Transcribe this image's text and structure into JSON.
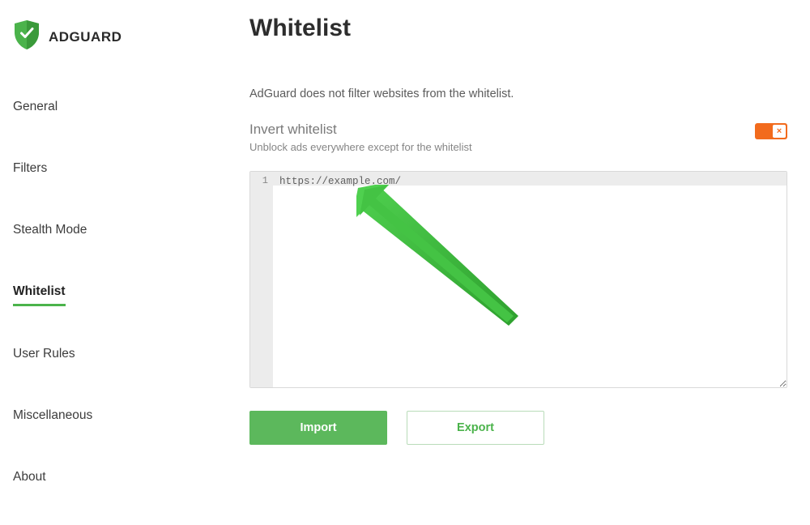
{
  "brand": {
    "name": "ADGUARD"
  },
  "sidebar": {
    "items": [
      {
        "label": "General"
      },
      {
        "label": "Filters"
      },
      {
        "label": "Stealth Mode"
      },
      {
        "label": "Whitelist"
      },
      {
        "label": "User Rules"
      },
      {
        "label": "Miscellaneous"
      },
      {
        "label": "About"
      }
    ]
  },
  "main": {
    "title": "Whitelist",
    "description": "AdGuard does not filter websites from the whitelist.",
    "invert": {
      "title": "Invert whitelist",
      "subtitle": "Unblock ads everywhere except for the whitelist",
      "enabled_icon_glyph": "×"
    },
    "editor": {
      "line_number": "1",
      "content": "https://example.com/"
    },
    "buttons": {
      "import": "Import",
      "export": "Export"
    }
  },
  "colors": {
    "accent_green": "#4bb34b",
    "button_green": "#5cb85c",
    "toggle_orange": "#f26b1d"
  }
}
